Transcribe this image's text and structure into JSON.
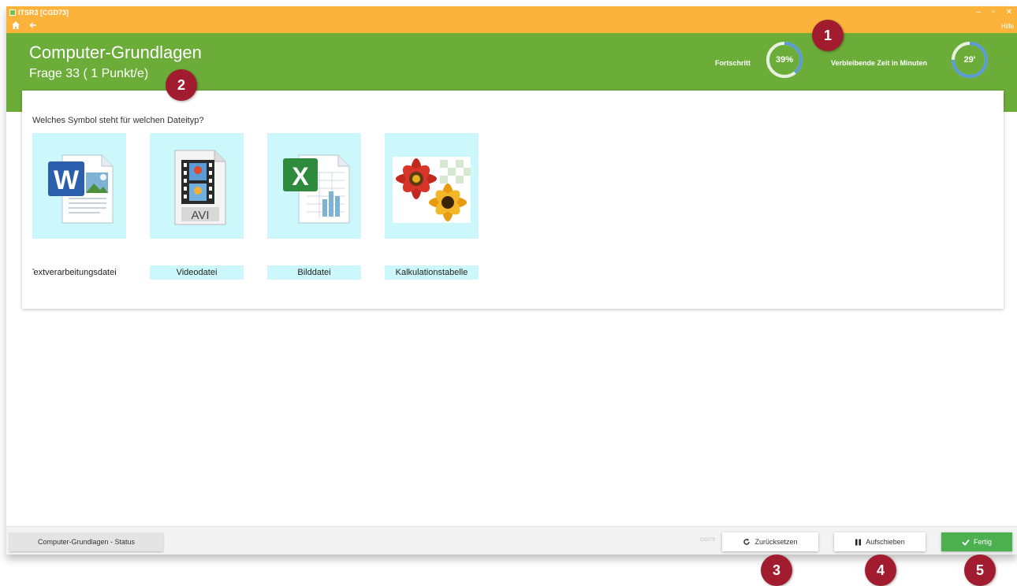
{
  "window": {
    "title": "ITSR3 [CGD73]",
    "controls": [
      "–",
      "▫",
      "✕"
    ],
    "help": "Hilfe"
  },
  "header": {
    "course_title": "Computer-Grundlagen",
    "question_info": "Frage 33 ( 1 Punkt/e)",
    "progress_label": "Fortschritt",
    "progress_value": "39%",
    "progress_fraction": 0.39,
    "time_label": "Verbleibende Zeit in Minuten",
    "time_value": "29'",
    "time_fraction": 0.75,
    "ring_color": "#5b9bd5"
  },
  "question": {
    "text": "Welches Symbol steht für welchen Dateityp?",
    "icons": [
      "word-document-icon",
      "avi-video-icon",
      "excel-spreadsheet-icon",
      "flower-image-icon"
    ],
    "icon_text": {
      "word": "W",
      "video": "AVI",
      "excel": "X"
    },
    "labels": [
      "Textverarbeitungsdatei",
      "Videodatei",
      "Bilddatei",
      "Kalkulationstabelle"
    ]
  },
  "footer": {
    "status_button": "Computer-Grundlagen - Status",
    "item_code": "CG073",
    "reset_button": "Zurücksetzen",
    "postpone_button": "Aufschieben",
    "done_button": "Fertig"
  },
  "markers": [
    "1",
    "2",
    "3",
    "4",
    "5"
  ],
  "colors": {
    "titlebar": "#fbb33c",
    "header": "#6cad3a",
    "tile": "#ccf8fc",
    "done": "#4caf50",
    "marker": "#a11c2f"
  }
}
